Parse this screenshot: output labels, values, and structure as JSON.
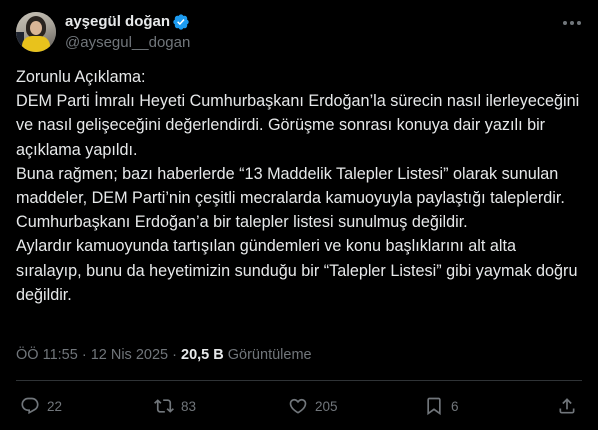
{
  "author": {
    "display_name": "ayşegül doğan",
    "handle": "@aysegul__dogan",
    "verified_icon": "verified-badge-icon",
    "verified_color": "#1d9bf0"
  },
  "tweet": {
    "paragraphs": [
      "Zorunlu Açıklama:",
      "DEM Parti İmralı Heyeti Cumhurbaşkanı Erdoğan’la sürecin nasıl ilerleyeceğini ve nasıl gelişeceğini değerlendirdi. Görüşme sonrası konuya dair yazılı bir açıklama yapıldı.",
      "Buna rağmen; bazı haberlerde “13 Maddelik Talepler Listesi” olarak sunulan maddeler, DEM Parti’nin çeşitli mecralarda kamuoyuyla paylaştığı taleplerdir. Cumhurbaşkanı Erdoğan’a bir talepler listesi sunulmuş değildir.",
      "Aylardır kamuoyunda tartışılan gündemleri ve konu başlıklarını alt alta sıralayıp, bunu da heyetimizin sunduğu bir “Talepler Listesi” gibi yaymak doğru değildir."
    ],
    "time": "ÖÖ 11:55",
    "separator": "·",
    "date": "12 Nis 2025",
    "views_count": "20,5 B",
    "views_label": "Görüntüleme"
  },
  "actions": {
    "replies": "22",
    "reposts": "83",
    "likes": "205",
    "bookmarks": "6"
  },
  "colors": {
    "background": "#000000",
    "text": "#e7e9ea",
    "muted": "#71767b",
    "divider": "#2f3336"
  }
}
